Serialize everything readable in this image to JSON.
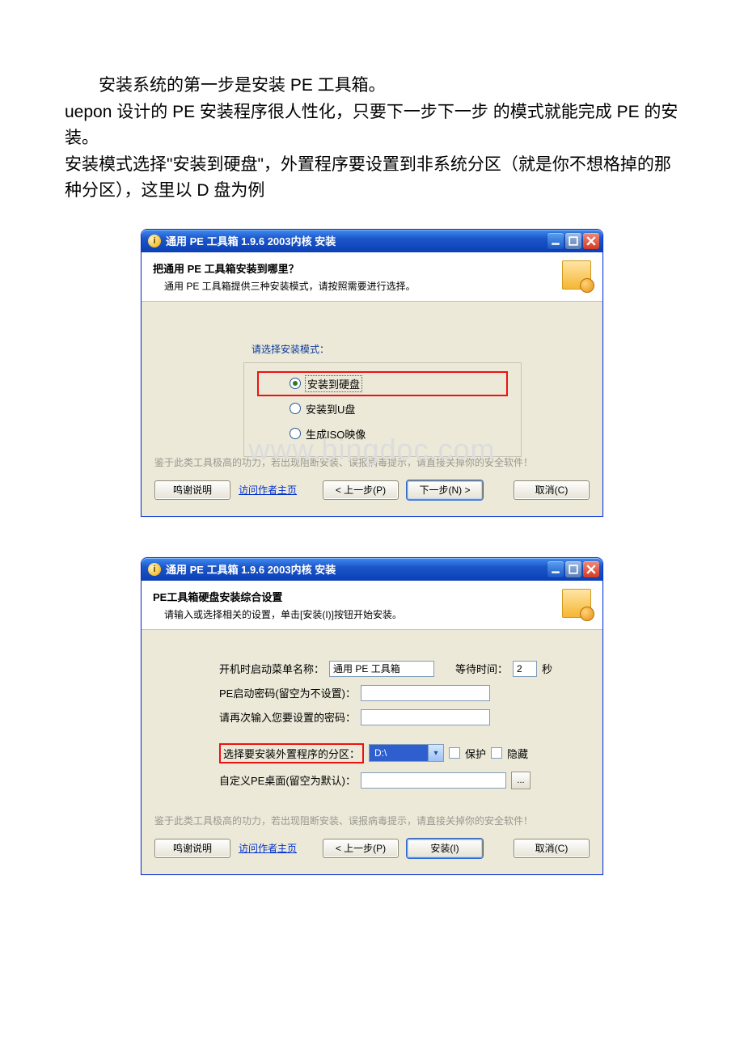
{
  "document": {
    "p1": "安装系统的第一步是安装 PE 工具箱。",
    "p2": "uepon 设计的 PE 安装程序很人性化，只要下一步下一步 的模式就能完成 PE 的安装。",
    "p3": "安装模式选择\"安装到硬盘\"，外置程序要设置到非系统分区（就是你不想格掉的那种分区），这里以 D 盘为例",
    "watermark": "www.bingdoc.com"
  },
  "window1": {
    "title": "通用 PE 工具箱 1.9.6 2003内核 安装",
    "headerTitle": "把通用 PE 工具箱安装到哪里？",
    "headerSub": "通用 PE 工具箱提供三种安装模式，请按照需要进行选择。",
    "groupLabel": "请选择安装模式：",
    "opt1": "安装到硬盘",
    "opt2": "安装到U盘",
    "opt3": "生成ISO映像",
    "footnote": "鉴于此类工具极高的功力，若出现阻断安装、误报病毒提示，请直接关掉你的安全软件！",
    "btnThanks": "鸣谢说明",
    "linkAuthor": "访问作者主页",
    "btnPrev": "< 上一步(P)",
    "btnNext": "下一步(N) >",
    "btnCancel": "取消(C)"
  },
  "window2": {
    "title": "通用 PE 工具箱 1.9.6 2003内核 安装",
    "headerTitle": "PE工具箱硬盘安装综合设置",
    "headerSub": "请输入或选择相关的设置，单击[安装(I)]按钮开始安装。",
    "lblBootMenu": "开机时启动菜单名称：",
    "valBootMenu": "通用 PE 工具箱",
    "lblWait": "等待时间：",
    "valWait": "2",
    "lblWaitUnit": "秒",
    "lblPass1": "PE启动密码(留空为不设置)：",
    "lblPass2": "请再次输入您要设置的密码：",
    "lblPartition": "选择要安装外置程序的分区：",
    "valPartition": "D:\\",
    "chkProtect": "保护",
    "chkHide": "隐藏",
    "lblDesktop": "自定义PE桌面(留空为默认)：",
    "browse": "...",
    "footnote": "鉴于此类工具极高的功力，若出现阻断安装、误报病毒提示，请直接关掉你的安全软件！",
    "btnThanks": "鸣谢说明",
    "linkAuthor": "访问作者主页",
    "btnPrev": "< 上一步(P)",
    "btnInstall": "安装(I)",
    "btnCancel": "取消(C)"
  }
}
